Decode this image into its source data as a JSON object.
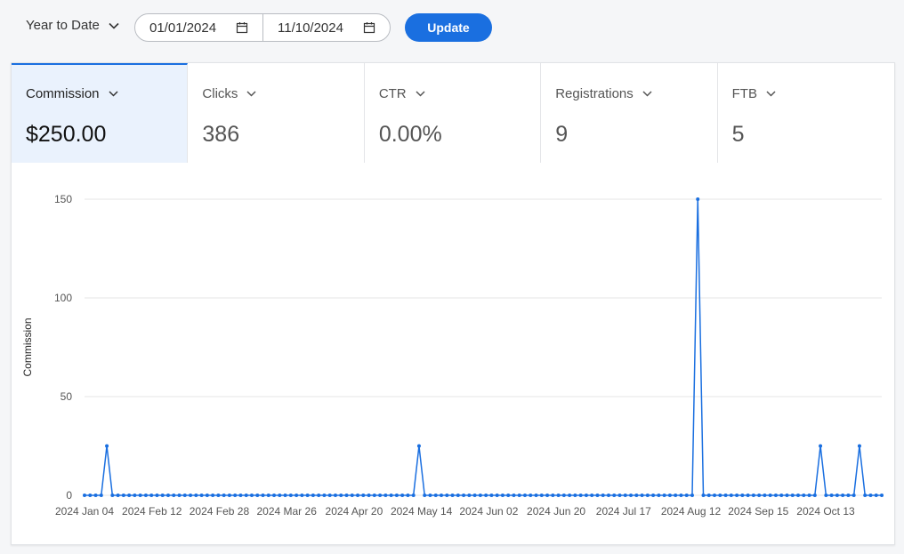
{
  "toolbar": {
    "range_label": "Year to Date",
    "start_date": "01/01/2024",
    "end_date": "11/10/2024",
    "update_label": "Update",
    "accent_color": "#1a6fe0"
  },
  "tabs": [
    {
      "label": "Commission",
      "value": "$250.00",
      "active": true
    },
    {
      "label": "Clicks",
      "value": "386",
      "active": false
    },
    {
      "label": "CTR",
      "value": "0.00%",
      "active": false
    },
    {
      "label": "Registrations",
      "value": "9",
      "active": false
    },
    {
      "label": "FTB",
      "value": "5",
      "active": false
    }
  ],
  "chart_data": {
    "type": "line",
    "title": "",
    "xlabel": "",
    "ylabel": "Commission",
    "ylim": [
      0,
      150
    ],
    "yticks": [
      0,
      50,
      100,
      150
    ],
    "xticks": [
      "2024 Jan 04",
      "2024 Feb 12",
      "2024 Feb 28",
      "2024 Mar 26",
      "2024 Apr 20",
      "2024 May 14",
      "2024 Jun 02",
      "2024 Jun 20",
      "2024 Jul 17",
      "2024 Aug 12",
      "2024 Sep 15",
      "2024 Oct 13"
    ],
    "grid": true,
    "point_count": 144,
    "series": [
      {
        "color": "#1a6fe0",
        "spikes": [
          {
            "index": 4,
            "value": 25
          },
          {
            "index": 60,
            "value": 25
          },
          {
            "index": 110,
            "value": 150
          },
          {
            "index": 132,
            "value": 25
          },
          {
            "index": 139,
            "value": 25
          }
        ],
        "baseline": 0
      }
    ]
  }
}
